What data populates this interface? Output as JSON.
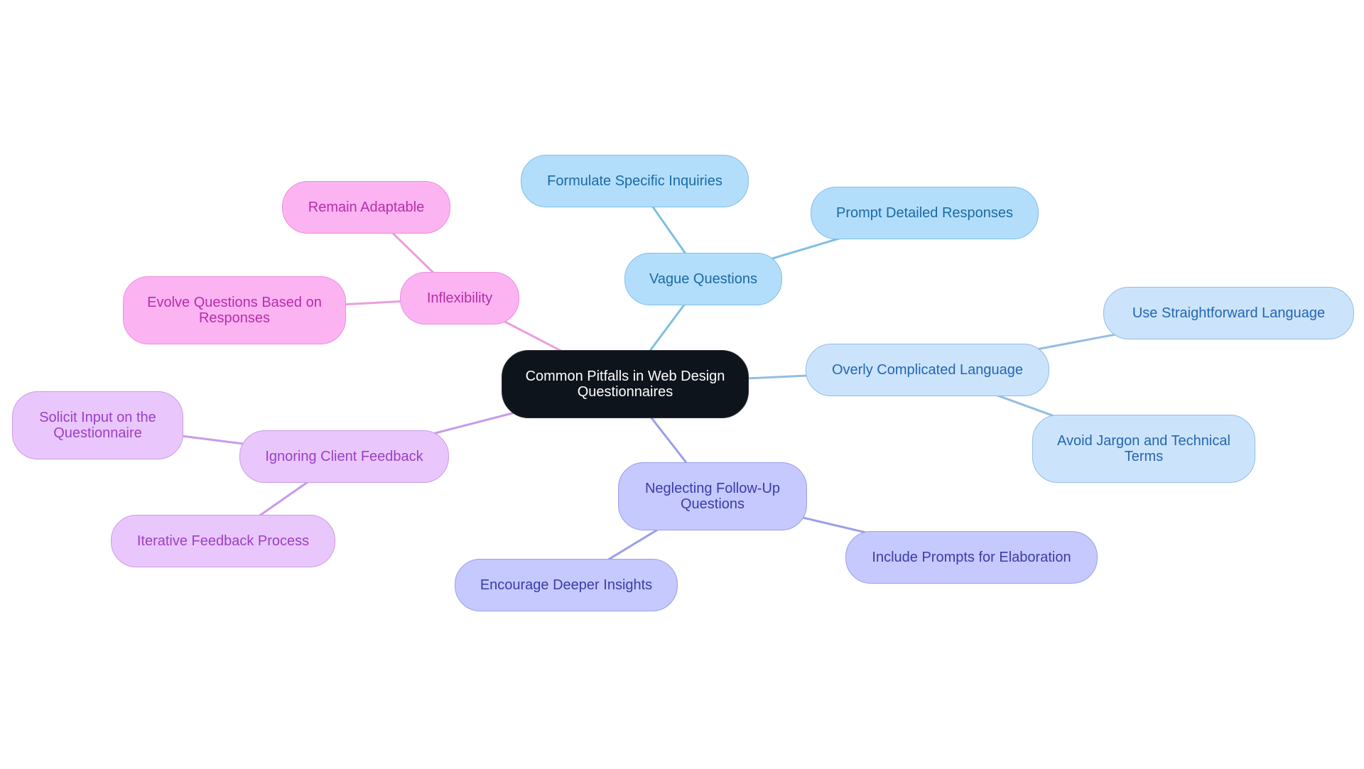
{
  "diagram": {
    "type": "mind-map",
    "root": {
      "id": "root",
      "label": "Common Pitfalls in Web Design Questionnaires"
    },
    "colors": {
      "vague": "#7fbfe2",
      "language": "#93bde2",
      "followup": "#9a9ee9",
      "feedback": "#c99ae8",
      "inflexibility": "#eb9ddf"
    },
    "branches": [
      {
        "id": "vague",
        "label": "Vague Questions",
        "theme": "vague",
        "children": [
          {
            "id": "vague-1",
            "label": "Formulate Specific Inquiries"
          },
          {
            "id": "vague-2",
            "label": "Prompt Detailed Responses"
          }
        ]
      },
      {
        "id": "language",
        "label": "Overly Complicated Language",
        "theme": "language",
        "children": [
          {
            "id": "language-1",
            "label": "Use Straightforward Language"
          },
          {
            "id": "language-2",
            "label": "Avoid Jargon and Technical Terms"
          }
        ]
      },
      {
        "id": "followup",
        "label": "Neglecting Follow-Up Questions",
        "theme": "followup",
        "children": [
          {
            "id": "followup-1",
            "label": "Include Prompts for Elaboration"
          },
          {
            "id": "followup-2",
            "label": "Encourage Deeper Insights"
          }
        ]
      },
      {
        "id": "feedback",
        "label": "Ignoring Client Feedback",
        "theme": "feedback",
        "children": [
          {
            "id": "feedback-1",
            "label": "Solicit Input on the Questionnaire"
          },
          {
            "id": "feedback-2",
            "label": "Iterative Feedback Process"
          }
        ]
      },
      {
        "id": "inflexibility",
        "label": "Inflexibility",
        "theme": "inflexibility",
        "children": [
          {
            "id": "inflexibility-1",
            "label": "Remain Adaptable"
          },
          {
            "id": "inflexibility-2",
            "label": "Evolve Questions Based on Responses"
          }
        ]
      }
    ]
  }
}
